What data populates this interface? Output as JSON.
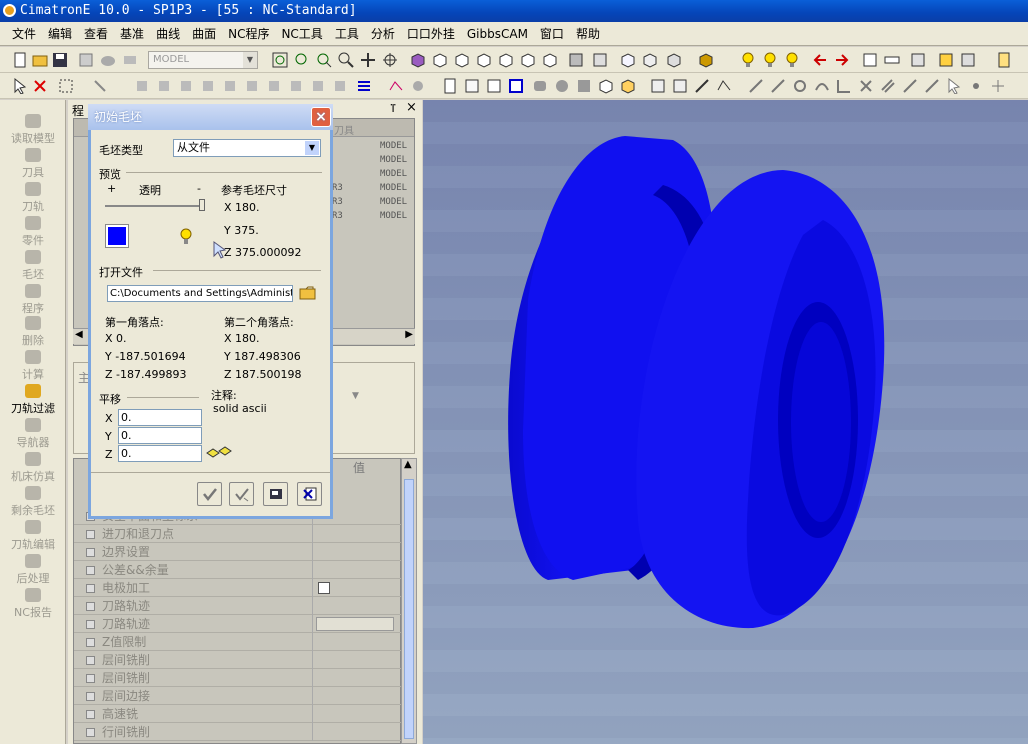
{
  "window": {
    "title": "CimatronE 10.0 - SP1P3 - [55 : NC-Standard]"
  },
  "menu": [
    "文件",
    "编辑",
    "查看",
    "基准",
    "曲线",
    "曲面",
    "NC程序",
    "NC工具",
    "工具",
    "分析",
    "口口外挂",
    "GibbsCAM",
    "窗口",
    "帮助"
  ],
  "toolbar": {
    "model_combo": "MODEL"
  },
  "leftbar": [
    "读取模型",
    "刀具",
    "刀轨",
    "零件",
    "毛坯",
    "程序",
    "删除",
    "计算",
    "刀轨过滤",
    "导航器",
    "机床仿真",
    "剩余毛坯",
    "刀轨编辑",
    "后处理",
    "NC报告"
  ],
  "panel": {
    "title": "程",
    "tree_header": "刀具",
    "model_rows": [
      "MODEL",
      "MODEL",
      "MODEL",
      "MODEL",
      "MODEL",
      "MODEL"
    ],
    "r3_rows": [
      "R3",
      "R3",
      "R3"
    ],
    "middle_label": "主",
    "value_header": "值",
    "param_rows": [
      "安全平面和坐标系",
      "进刀和退刀点",
      "边界设置",
      "公差&&余量",
      "电极加工",
      "刀路轨迹",
      "刀路轨迹",
      "Z值限制",
      "层间铣削",
      "层间铣削",
      "层间边接",
      "高速铣",
      "行间铣削"
    ]
  },
  "dialog": {
    "title": "初始毛坯",
    "stock_type_label": "毛坯类型",
    "stock_type_value": "从文件",
    "preview_label": "预览",
    "plus": "+",
    "transparency": "透明",
    "minus": "-",
    "ref_size_label": "参考毛坯尺寸",
    "ref_x": "X 180.",
    "ref_y": "Y 375.",
    "ref_z": "Z 375.000092",
    "open_file_label": "打开文件",
    "file_path": "C:\\Documents and Settings\\Administra",
    "corner1_label": "第一角落点:",
    "c1x": "X 0.",
    "c1y": "Y -187.501694",
    "c1z": "Z -187.499893",
    "corner2_label": "第二个角落点:",
    "c2x": "X 180.",
    "c2y": "Y 187.498306",
    "c2z": "Z 187.500198",
    "translate_label": "平移",
    "note_label": "注释:",
    "note_value": "solid ascii",
    "tx_label": "X",
    "tx": "0.",
    "ty_label": "Y",
    "ty": "0.",
    "tz_label": "Z",
    "tz": "0.",
    "swatch_color": "#0000ff"
  },
  "viewport": {
    "model_color": "#1010e8"
  }
}
